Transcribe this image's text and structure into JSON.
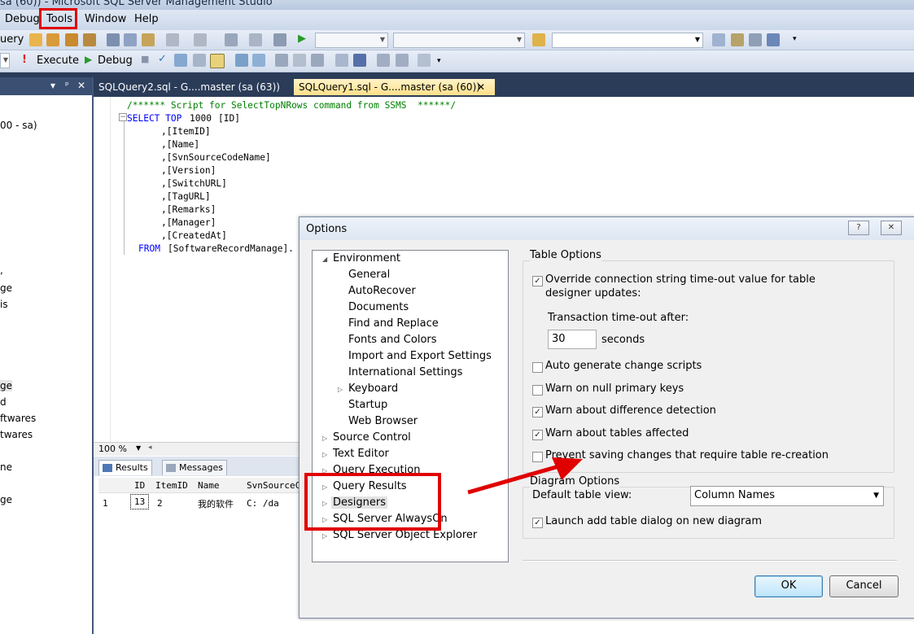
{
  "window": {
    "title": "sa (60)) - Microsoft SQL Server Management Studio"
  },
  "menu": [
    "Debug",
    "Tools",
    "Window",
    "Help"
  ],
  "toolbar1": {
    "left_text": "uery"
  },
  "toolbar2": {
    "execute": "Execute",
    "debug": "Debug"
  },
  "object_explorer": {
    "lines": [
      "00 - sa)",
      ",",
      "ge",
      "is",
      "ge",
      "d",
      "ftwares",
      "twares",
      "ne",
      "ge"
    ]
  },
  "tabs": [
    {
      "label": "SQLQuery2.sql - G....master (sa (63))",
      "active": false
    },
    {
      "label": "SQLQuery1.sql - G....master (sa (60))",
      "active": true
    }
  ],
  "close_glyph": "✕",
  "pin_glyph": "▾ ᵖ ✕",
  "code": {
    "comment": "/****** Script for SelectTopNRows command from SSMS  ******/",
    "select_kw": "SELECT TOP",
    "top_n": "1000",
    "first_col": "[ID]",
    "columns": [
      ",[ItemID]",
      ",[Name]",
      ",[SvnSourceCodeName]",
      ",[Version]",
      ",[SwitchURL]",
      ",[TagURL]",
      ",[Remarks]",
      ",[Manager]",
      ",[CreatedAt]"
    ],
    "from_kw": "FROM",
    "from_table": "[SoftwareRecordManage]."
  },
  "zoom": "100 %",
  "results": {
    "tab_results": "Results",
    "tab_messages": "Messages",
    "headers": [
      "ID",
      "ItemID",
      "Name",
      "SvnSourceCo"
    ],
    "row": {
      "num": "1",
      "id": "13",
      "itemid": "2",
      "name": "我的软件",
      "svn": "C: /da"
    }
  },
  "dialog": {
    "title": "Options",
    "help_btn": "?",
    "close_btn": "✕",
    "tree": [
      {
        "label": "Environment",
        "level": 0,
        "expander": "◢"
      },
      {
        "label": "General",
        "level": 1
      },
      {
        "label": "AutoRecover",
        "level": 1
      },
      {
        "label": "Documents",
        "level": 1
      },
      {
        "label": "Find and Replace",
        "level": 1
      },
      {
        "label": "Fonts and Colors",
        "level": 1
      },
      {
        "label": "Import and Export Settings",
        "level": 1
      },
      {
        "label": "International Settings",
        "level": 1
      },
      {
        "label": "Keyboard",
        "level": 1,
        "expander": "▷"
      },
      {
        "label": "Startup",
        "level": 1
      },
      {
        "label": "Web Browser",
        "level": 1
      },
      {
        "label": "Source Control",
        "level": 0,
        "expander": "▷"
      },
      {
        "label": "Text Editor",
        "level": 0,
        "expander": "▷"
      },
      {
        "label": "Query Execution",
        "level": 0,
        "expander": "▷"
      },
      {
        "label": "Query Results",
        "level": 0,
        "expander": "▷"
      },
      {
        "label": "Designers",
        "level": 0,
        "expander": "▷",
        "selected": true
      },
      {
        "label": "SQL Server AlwaysOn",
        "level": 0,
        "expander": "▷"
      },
      {
        "label": "SQL Server Object Explorer",
        "level": 0,
        "expander": "▷"
      }
    ],
    "table_options": {
      "title": "Table Options",
      "override_line1": "Override connection string time-out value for table",
      "override_line2": "designer updates:",
      "override_checked": true,
      "timeout_label": "Transaction time-out after:",
      "timeout_value": "30",
      "timeout_unit": "seconds",
      "auto_generate": "Auto generate change scripts",
      "auto_generate_checked": false,
      "warn_null": "Warn on null primary keys",
      "warn_null_checked": false,
      "warn_diff": "Warn about difference detection",
      "warn_diff_checked": true,
      "warn_tables": "Warn about tables affected",
      "warn_tables_checked": true,
      "prevent_saving": "Prevent saving changes that require table re-creation",
      "prevent_saving_checked": false
    },
    "diagram_options": {
      "title": "Diagram Options",
      "default_view_label": "Default table view:",
      "default_view_value": "Column Names",
      "launch_add_table": "Launch add table dialog on new diagram",
      "launch_add_table_checked": true
    },
    "ok": "OK",
    "cancel": "Cancel"
  },
  "colors": {
    "annotation_red": "#e00000",
    "window_bg": "#2b3c59",
    "sql_keyword": "#0000ff",
    "sql_comment": "#008000"
  },
  "check_glyph": "✓"
}
